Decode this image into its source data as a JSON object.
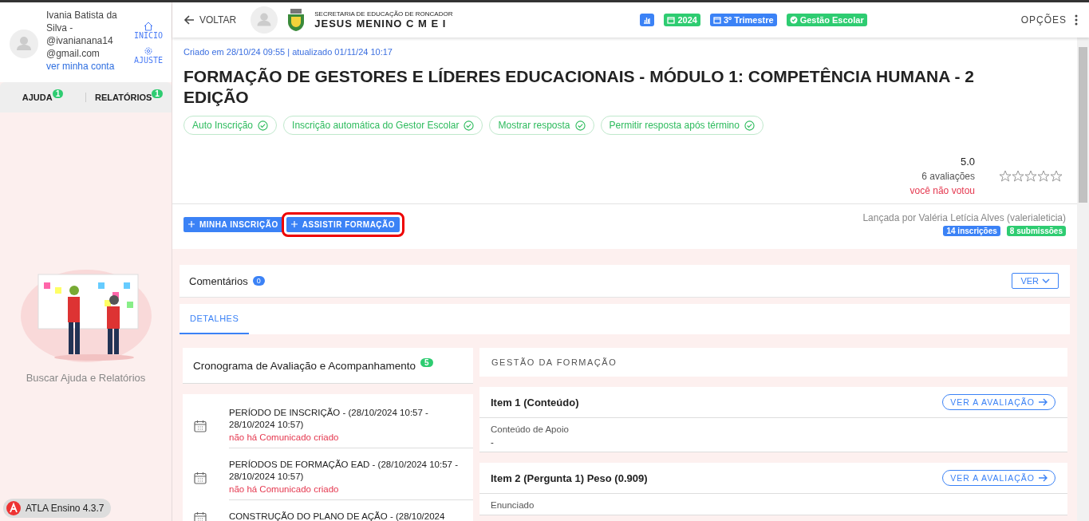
{
  "sidebar": {
    "user_name": "Ivania Batista da Silva - @ivanianana14@gmail.com",
    "account_link": "ver minha conta",
    "nav": [
      {
        "label": "INICIO",
        "kind": "home"
      },
      {
        "label": "AJUSTE",
        "kind": "settings"
      }
    ],
    "tabs": [
      {
        "label": "AJUDA",
        "count": "1"
      },
      {
        "label": "RELATÓRIOS",
        "count": "1"
      }
    ],
    "help_text": "Buscar Ajuda e Relatórios",
    "version": "ATLA Ensino 4.3.7"
  },
  "header": {
    "back": "VOLTAR",
    "org_subtitle": "SECRETARIA DE EDUCAÇÃO DE RONCADOR",
    "org_name": "JESUS MENINO C M E I",
    "badges": [
      {
        "kind": "chart",
        "color": "#3b82f6"
      },
      {
        "kind": "calendar",
        "label": "2024",
        "color": "#2ecc71"
      },
      {
        "kind": "calendar",
        "label": "3º Trimestre",
        "color": "#3b82f6"
      },
      {
        "kind": "check",
        "label": "Gestão Escolar",
        "color": "#2ecc71"
      }
    ],
    "options": "OPÇÕES"
  },
  "course": {
    "meta": "Criado em 28/10/24 09:55 | atualizado 01/11/24 10:17",
    "title": "FORMAÇÃO DE GESTORES E LÍDERES EDUCACIONAIS - MÓDULO 1: COMPETÊNCIA HUMANA - 2 EDIÇÃO",
    "options": [
      {
        "label": "Auto Inscrição",
        "checked": true
      },
      {
        "label": "Inscrição automática do Gestor Escolar",
        "checked": true
      },
      {
        "label": "Mostrar resposta",
        "checked": true
      },
      {
        "label": "Permitir resposta após término",
        "checked": true
      }
    ],
    "rating": {
      "score": "5.0",
      "count": "6 avaliações",
      "note": "você não votou",
      "stars": 0
    },
    "buttons": [
      {
        "label": "MINHA INSCRIÇÃO",
        "highlighted": false
      },
      {
        "label": "ASSISTIR FORMAÇÃO",
        "highlighted": true
      }
    ],
    "launched_by": "Lançada por Valéria Letícia Alves (valerialeticia)",
    "counts": [
      {
        "label": "14 inscrições",
        "color": "#3b82f6"
      },
      {
        "label": "8 submissões",
        "color": "#2ecc71"
      }
    ]
  },
  "comments": {
    "title": "Comentários",
    "count": "0",
    "button": "VER"
  },
  "tabs": [
    {
      "label": "DETALHES",
      "selected": true
    }
  ],
  "schedule": {
    "title": "Cronograma de Avaliação e Acompanhamento",
    "count": "5",
    "items": [
      {
        "title": "PERÍODO DE INSCRIÇÃO - (28/10/2024 10:57 - 28/10/2024 10:57)",
        "note": "não há Comunicado criado"
      },
      {
        "title": "PERÍODOS DE FORMAÇÃO EAD - (28/10/2024 10:57 - 28/10/2024 10:57)",
        "note": "não há Comunicado criado"
      },
      {
        "title": "CONSTRUÇÃO DO PLANO DE AÇÃO - (28/10/2024"
      }
    ]
  },
  "management": {
    "title": "GESTÃO DA FORMAÇÃO",
    "items": [
      {
        "title": "Item 1 (Conteúdo)",
        "button": "VER A AVALIAÇÃO",
        "field_label": "Conteúdo de Apoio",
        "field_value": "-"
      },
      {
        "title": "Item 2 (Pergunta 1) Peso (0.909)",
        "button": "VER A AVALIAÇÃO",
        "field_label": "Enunciado"
      }
    ]
  }
}
